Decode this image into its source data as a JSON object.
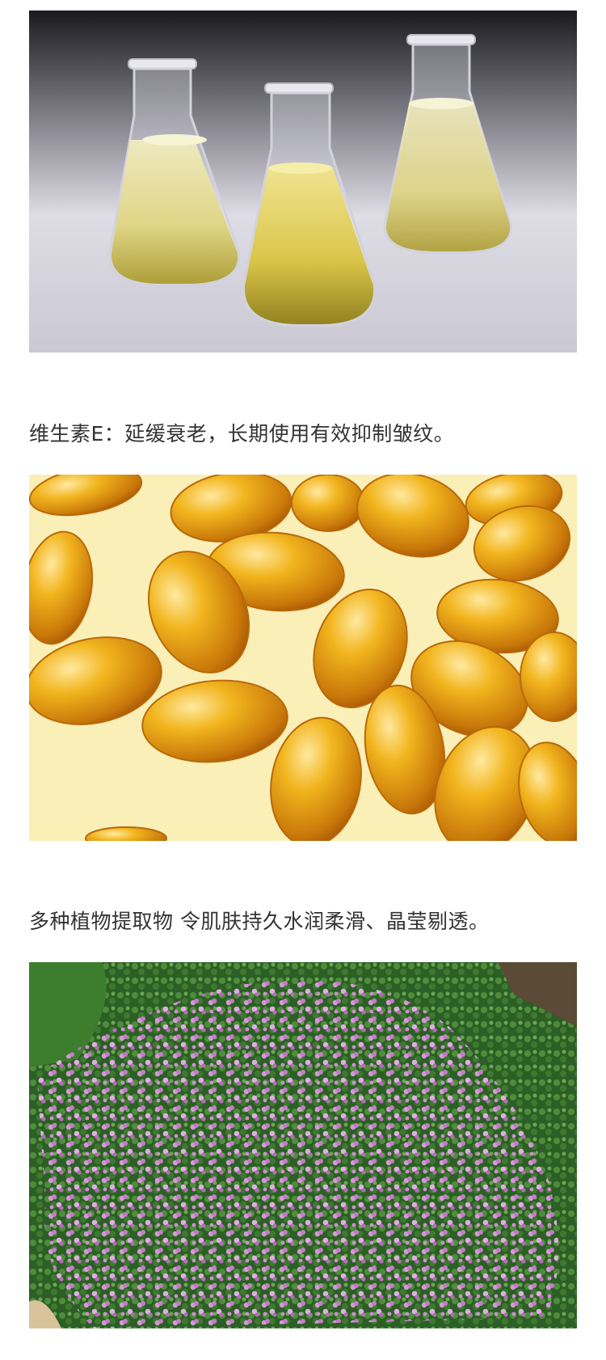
{
  "sections": [
    {
      "caption": "维生素E：延缓衰老，长期使用有效抑制皱纹。"
    },
    {
      "caption": "多种植物提取物 令肌肤持久水润柔滑、晶莹剔透。"
    }
  ],
  "colors": {
    "text": "#333333",
    "oil_yellow": "#d8c44a",
    "capsule_amber": "#d98a10",
    "flower_pink": "#c77fc8",
    "leaf_green": "#2f6b2a"
  }
}
